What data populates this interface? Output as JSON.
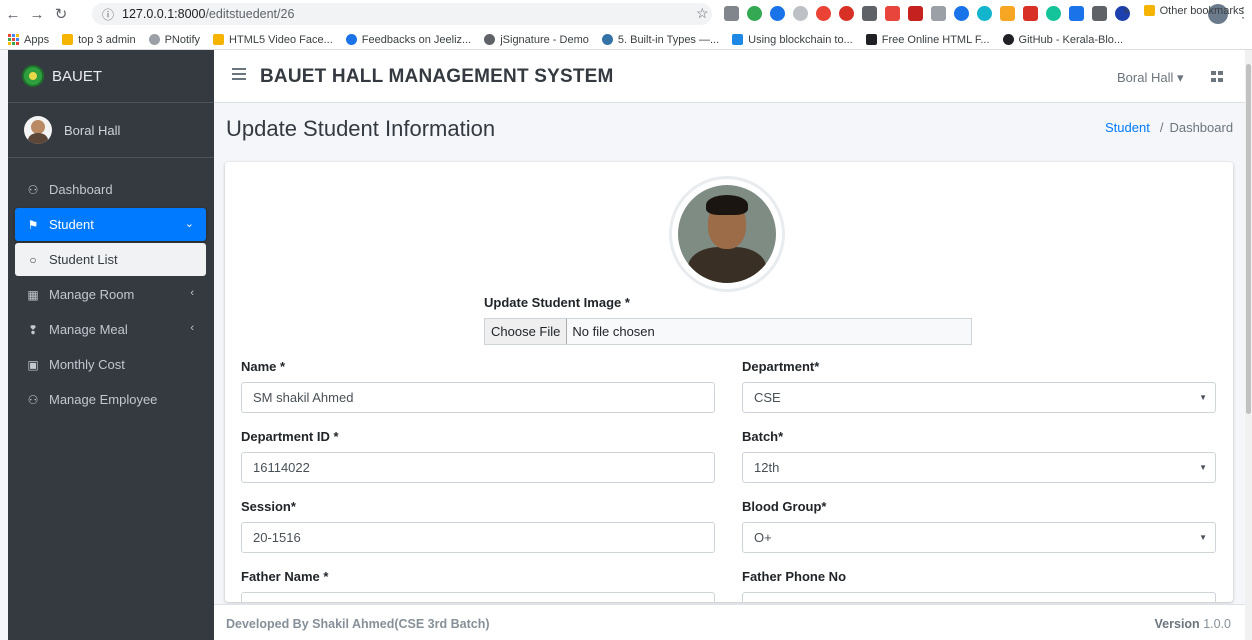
{
  "browser": {
    "url_host": "127.0.0.1:8000",
    "url_path": "/editstuedent/26",
    "bookmarks": [
      {
        "label": "Apps",
        "color": "#4285f4"
      },
      {
        "label": "top 3 admin",
        "color": "#f4b400"
      },
      {
        "label": "PNotify",
        "color": "#9aa0a6"
      },
      {
        "label": "HTML5 Video Face...",
        "color": "#f4b400"
      },
      {
        "label": "Feedbacks on Jeeliz...",
        "color": "#1a73e8"
      },
      {
        "label": "jSignature - Demo",
        "color": "#5f6368"
      },
      {
        "label": "5. Built-in Types —...",
        "color": "#3572a5"
      },
      {
        "label": "Using blockchain to...",
        "color": "#1e88e5"
      },
      {
        "label": "Free Online HTML F...",
        "color": "#202124"
      },
      {
        "label": "GitHub - Kerala-Blo...",
        "color": "#202124"
      }
    ],
    "more_bookmarks": "»",
    "other_bookmarks": "Other bookmarks"
  },
  "sidebar": {
    "brand": "BAUET",
    "user": "Boral Hall",
    "items": [
      {
        "label": "Dashboard",
        "icon": "users-icon",
        "glyph": "⚇",
        "state": "normal",
        "caret": ""
      },
      {
        "label": "Student",
        "icon": "graduation-icon",
        "glyph": "⚑",
        "state": "active",
        "caret": "⌄"
      },
      {
        "label": "Student List",
        "icon": "circle-icon",
        "glyph": "○",
        "state": "sub",
        "caret": ""
      },
      {
        "label": "Manage Room",
        "icon": "building-icon",
        "glyph": "▦",
        "state": "normal",
        "caret": "‹"
      },
      {
        "label": "Manage Meal",
        "icon": "utensils-icon",
        "glyph": "❢",
        "state": "normal",
        "caret": "‹"
      },
      {
        "label": "Monthly Cost",
        "icon": "money-icon",
        "glyph": "▣",
        "state": "normal",
        "caret": ""
      },
      {
        "label": "Manage Employee",
        "icon": "users-icon",
        "glyph": "⚇",
        "state": "normal",
        "caret": ""
      }
    ]
  },
  "navbar": {
    "title": "BAUET HALL MANAGEMENT SYSTEM",
    "hall_dropdown": "Boral Hall ▾"
  },
  "page": {
    "title": "Update Student Information",
    "breadcrumb_link": "Student",
    "breadcrumb_sep": "/",
    "breadcrumb_current": "Dashboard"
  },
  "form": {
    "image_label": "Update Student Image *",
    "file_button": "Choose File",
    "file_status": "No file chosen",
    "fields": {
      "name": {
        "label": "Name *",
        "value": "SM shakil Ahmed"
      },
      "department": {
        "label": "Department*",
        "value": "CSE"
      },
      "department_id": {
        "label": "Department ID *",
        "value": "16114022"
      },
      "batch": {
        "label": "Batch*",
        "value": "12th"
      },
      "session": {
        "label": "Session*",
        "value": "20-1516"
      },
      "blood_group": {
        "label": "Blood Group*",
        "value": "O+"
      },
      "father_name": {
        "label": "Father Name *",
        "value": ""
      },
      "father_phone": {
        "label": "Father Phone No",
        "value": ""
      }
    }
  },
  "footer": {
    "developer": "Developed By Shakil Ahmed(CSE 3rd Batch)",
    "version_label": "Version",
    "version_number": "1.0.0"
  }
}
